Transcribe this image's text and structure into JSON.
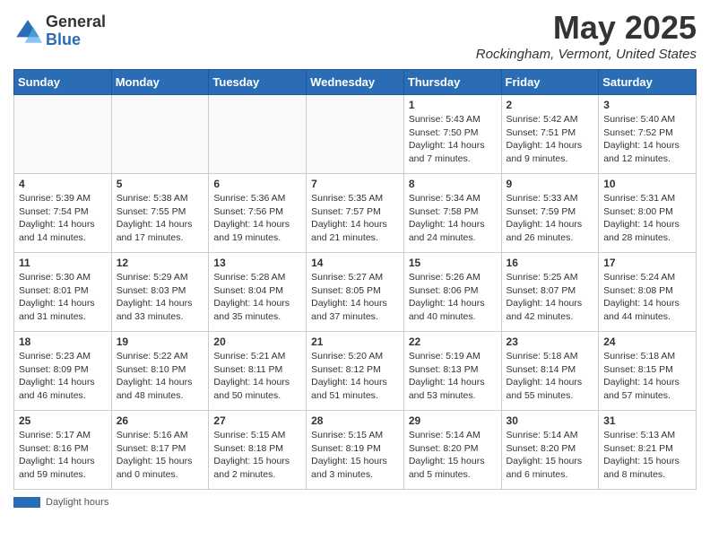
{
  "header": {
    "logo_general": "General",
    "logo_blue": "Blue",
    "month_title": "May 2025",
    "location": "Rockingham, Vermont, United States"
  },
  "days_of_week": [
    "Sunday",
    "Monday",
    "Tuesday",
    "Wednesday",
    "Thursday",
    "Friday",
    "Saturday"
  ],
  "footer": {
    "label": "Daylight hours"
  },
  "weeks": [
    [
      {
        "day": "",
        "info": ""
      },
      {
        "day": "",
        "info": ""
      },
      {
        "day": "",
        "info": ""
      },
      {
        "day": "",
        "info": ""
      },
      {
        "day": "1",
        "info": "Sunrise: 5:43 AM\nSunset: 7:50 PM\nDaylight: 14 hours\nand 7 minutes."
      },
      {
        "day": "2",
        "info": "Sunrise: 5:42 AM\nSunset: 7:51 PM\nDaylight: 14 hours\nand 9 minutes."
      },
      {
        "day": "3",
        "info": "Sunrise: 5:40 AM\nSunset: 7:52 PM\nDaylight: 14 hours\nand 12 minutes."
      }
    ],
    [
      {
        "day": "4",
        "info": "Sunrise: 5:39 AM\nSunset: 7:54 PM\nDaylight: 14 hours\nand 14 minutes."
      },
      {
        "day": "5",
        "info": "Sunrise: 5:38 AM\nSunset: 7:55 PM\nDaylight: 14 hours\nand 17 minutes."
      },
      {
        "day": "6",
        "info": "Sunrise: 5:36 AM\nSunset: 7:56 PM\nDaylight: 14 hours\nand 19 minutes."
      },
      {
        "day": "7",
        "info": "Sunrise: 5:35 AM\nSunset: 7:57 PM\nDaylight: 14 hours\nand 21 minutes."
      },
      {
        "day": "8",
        "info": "Sunrise: 5:34 AM\nSunset: 7:58 PM\nDaylight: 14 hours\nand 24 minutes."
      },
      {
        "day": "9",
        "info": "Sunrise: 5:33 AM\nSunset: 7:59 PM\nDaylight: 14 hours\nand 26 minutes."
      },
      {
        "day": "10",
        "info": "Sunrise: 5:31 AM\nSunset: 8:00 PM\nDaylight: 14 hours\nand 28 minutes."
      }
    ],
    [
      {
        "day": "11",
        "info": "Sunrise: 5:30 AM\nSunset: 8:01 PM\nDaylight: 14 hours\nand 31 minutes."
      },
      {
        "day": "12",
        "info": "Sunrise: 5:29 AM\nSunset: 8:03 PM\nDaylight: 14 hours\nand 33 minutes."
      },
      {
        "day": "13",
        "info": "Sunrise: 5:28 AM\nSunset: 8:04 PM\nDaylight: 14 hours\nand 35 minutes."
      },
      {
        "day": "14",
        "info": "Sunrise: 5:27 AM\nSunset: 8:05 PM\nDaylight: 14 hours\nand 37 minutes."
      },
      {
        "day": "15",
        "info": "Sunrise: 5:26 AM\nSunset: 8:06 PM\nDaylight: 14 hours\nand 40 minutes."
      },
      {
        "day": "16",
        "info": "Sunrise: 5:25 AM\nSunset: 8:07 PM\nDaylight: 14 hours\nand 42 minutes."
      },
      {
        "day": "17",
        "info": "Sunrise: 5:24 AM\nSunset: 8:08 PM\nDaylight: 14 hours\nand 44 minutes."
      }
    ],
    [
      {
        "day": "18",
        "info": "Sunrise: 5:23 AM\nSunset: 8:09 PM\nDaylight: 14 hours\nand 46 minutes."
      },
      {
        "day": "19",
        "info": "Sunrise: 5:22 AM\nSunset: 8:10 PM\nDaylight: 14 hours\nand 48 minutes."
      },
      {
        "day": "20",
        "info": "Sunrise: 5:21 AM\nSunset: 8:11 PM\nDaylight: 14 hours\nand 50 minutes."
      },
      {
        "day": "21",
        "info": "Sunrise: 5:20 AM\nSunset: 8:12 PM\nDaylight: 14 hours\nand 51 minutes."
      },
      {
        "day": "22",
        "info": "Sunrise: 5:19 AM\nSunset: 8:13 PM\nDaylight: 14 hours\nand 53 minutes."
      },
      {
        "day": "23",
        "info": "Sunrise: 5:18 AM\nSunset: 8:14 PM\nDaylight: 14 hours\nand 55 minutes."
      },
      {
        "day": "24",
        "info": "Sunrise: 5:18 AM\nSunset: 8:15 PM\nDaylight: 14 hours\nand 57 minutes."
      }
    ],
    [
      {
        "day": "25",
        "info": "Sunrise: 5:17 AM\nSunset: 8:16 PM\nDaylight: 14 hours\nand 59 minutes."
      },
      {
        "day": "26",
        "info": "Sunrise: 5:16 AM\nSunset: 8:17 PM\nDaylight: 15 hours\nand 0 minutes."
      },
      {
        "day": "27",
        "info": "Sunrise: 5:15 AM\nSunset: 8:18 PM\nDaylight: 15 hours\nand 2 minutes."
      },
      {
        "day": "28",
        "info": "Sunrise: 5:15 AM\nSunset: 8:19 PM\nDaylight: 15 hours\nand 3 minutes."
      },
      {
        "day": "29",
        "info": "Sunrise: 5:14 AM\nSunset: 8:20 PM\nDaylight: 15 hours\nand 5 minutes."
      },
      {
        "day": "30",
        "info": "Sunrise: 5:14 AM\nSunset: 8:20 PM\nDaylight: 15 hours\nand 6 minutes."
      },
      {
        "day": "31",
        "info": "Sunrise: 5:13 AM\nSunset: 8:21 PM\nDaylight: 15 hours\nand 8 minutes."
      }
    ]
  ]
}
